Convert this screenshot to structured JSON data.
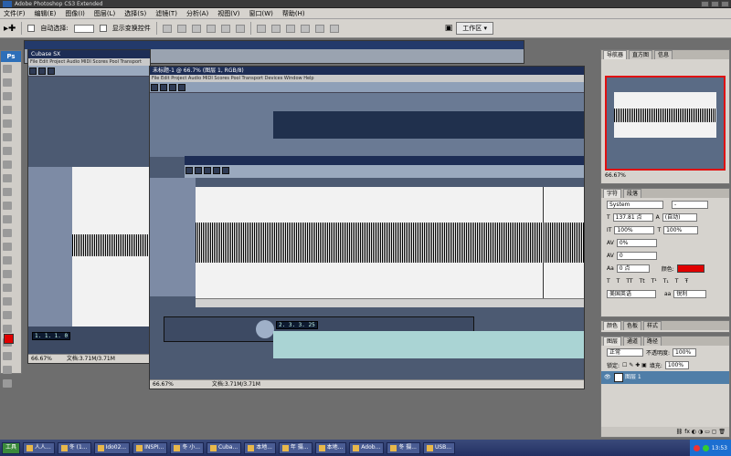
{
  "app_title": "Adobe Photoshop CS3 Extended",
  "menu": [
    "文件(F)",
    "编辑(E)",
    "图像(I)",
    "图层(L)",
    "选择(S)",
    "滤镜(T)",
    "分析(A)",
    "视图(V)",
    "窗口(W)",
    "帮助(H)"
  ],
  "options": {
    "auto_select": "自动选择:",
    "auto_select_value": "",
    "show_transform": "显示变换控件",
    "workspace": "工作区"
  },
  "doc_back": {
    "title": "Cubase SX",
    "zoom": "66.67%",
    "doc_info": "文档:3.71M/3.71M"
  },
  "doc_front": {
    "title": "未标题-1 @ 66.7% (图层 1, RGB/8)",
    "zoom": "66.67%",
    "doc_info": "文档:3.71M/3.71M"
  },
  "cubase": {
    "lcd_a": "1. 1. 1. 0",
    "lcd_b": "2. 3. 3. 25"
  },
  "navigator": {
    "tabs": [
      "导航器",
      "直方图",
      "信息"
    ],
    "zoom": "66.67%"
  },
  "character": {
    "tabs": [
      "字符",
      "段落"
    ],
    "font_family": "System",
    "font_style": "-",
    "font_size": "137.81 点",
    "leading": "(自动)",
    "vscale": "100%",
    "hscale": "100%",
    "tracking": "0%",
    "kerning": "0",
    "baseline": "0 点",
    "color_label": "颜色:",
    "color": "#e00000",
    "language": "美国英语",
    "aa_label": "aa",
    "aa_mode": "锐利"
  },
  "swatch_tabs": [
    "颜色",
    "色板",
    "样式"
  ],
  "layers": {
    "tabs": [
      "图层",
      "通道",
      "路径"
    ],
    "blend": "正常",
    "opacity_label": "不透明度:",
    "opacity": "100%",
    "lock_label": "锁定:",
    "fill_label": "填充:",
    "fill": "100%",
    "layer_name": "图层 1"
  },
  "taskbar": {
    "start": "工具",
    "tasks": [
      "人人...",
      "冬 (1...",
      "Ido02...",
      "INSPI...",
      "冬 小...",
      "Cuba...",
      "本地...",
      "年 摄...",
      "本地...",
      "Adob...",
      "冬 摄...",
      "USB..."
    ],
    "clock": "13:53"
  }
}
